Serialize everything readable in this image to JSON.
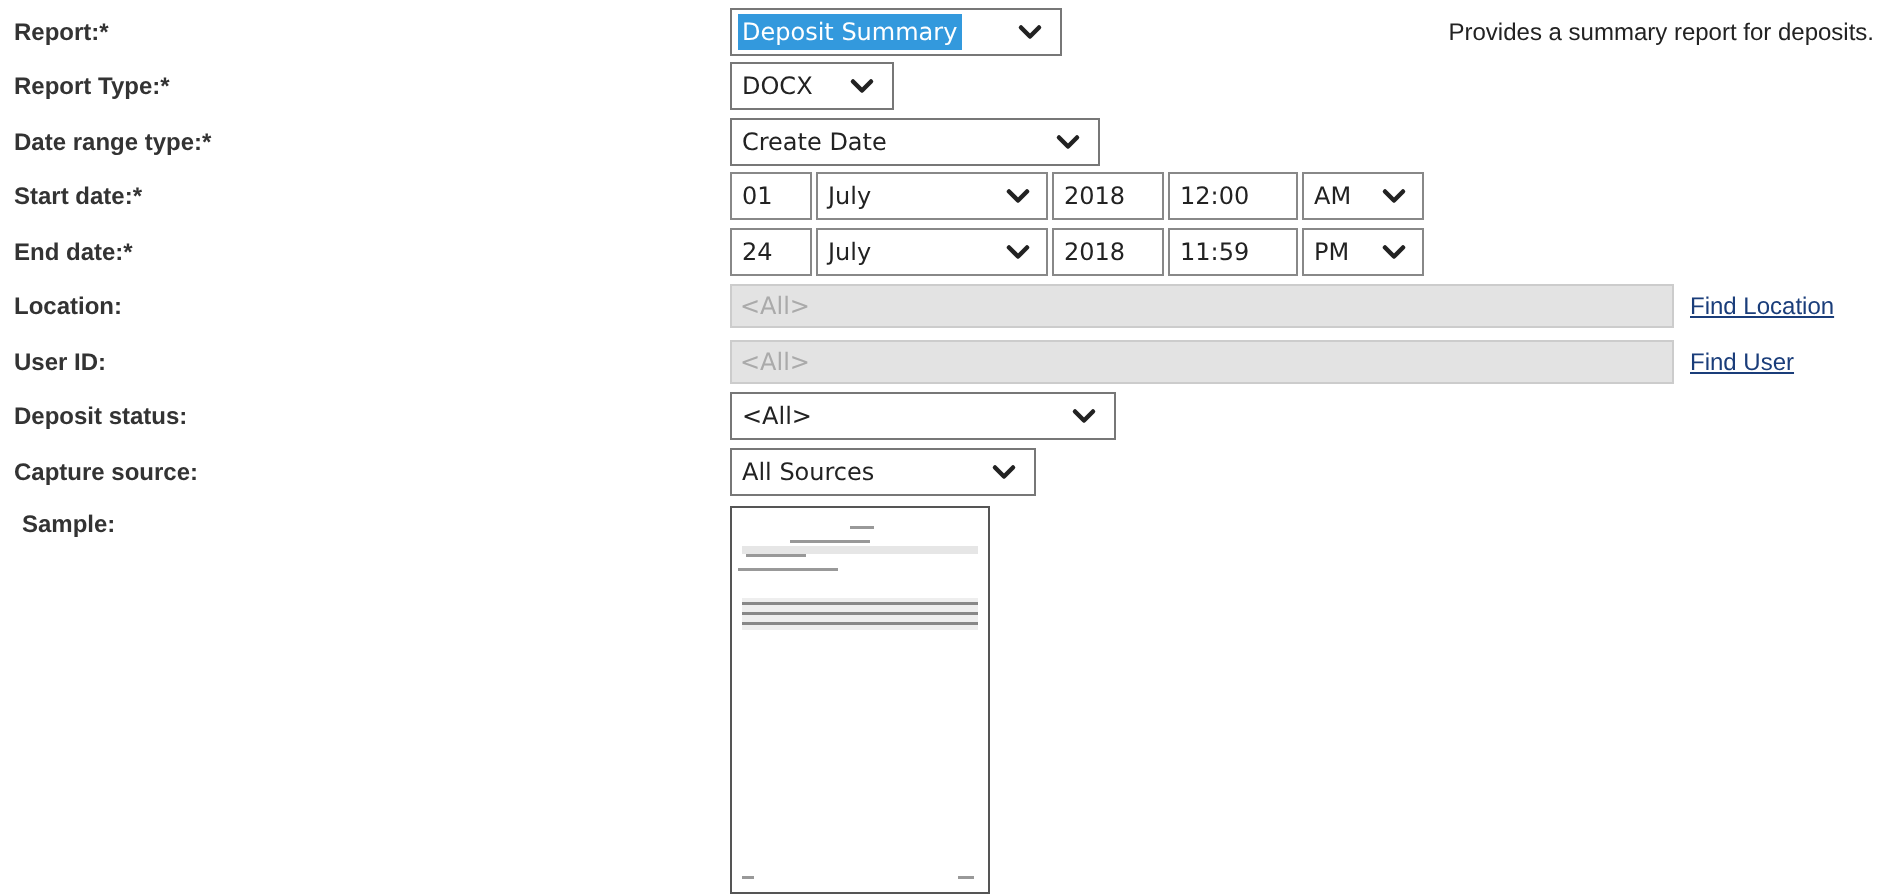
{
  "fields": [
    {
      "label": "Report:*",
      "kind": "select",
      "value": "Deposit Summary",
      "highlighted": true,
      "note": "Provides a summary report for deposits."
    },
    {
      "label": "Report Type:*",
      "kind": "select",
      "value": "DOCX",
      "highlighted": false
    },
    {
      "label": "Date range type:*",
      "kind": "select",
      "value": "Create Date",
      "highlighted": false
    },
    {
      "label": "Start date:*",
      "kind": "date",
      "day": "01",
      "month": "July",
      "year": "2018",
      "time": "12:00",
      "ampm": "AM"
    },
    {
      "label": "End date:*",
      "kind": "date",
      "day": "24",
      "month": "July",
      "year": "2018",
      "time": "11:59",
      "ampm": "PM"
    },
    {
      "label": "Location:",
      "kind": "lookup",
      "value": "<All>",
      "disabled": true,
      "link": "Find Location"
    },
    {
      "label": "User ID:",
      "kind": "lookup",
      "value": "<All>",
      "disabled": true,
      "link": "Find User"
    },
    {
      "label": "Deposit status:",
      "kind": "select",
      "value": "<All>",
      "highlighted": false
    },
    {
      "label": "Capture source:",
      "kind": "select",
      "value": "All Sources",
      "highlighted": false
    },
    {
      "label": "Sample:",
      "kind": "sample"
    }
  ]
}
